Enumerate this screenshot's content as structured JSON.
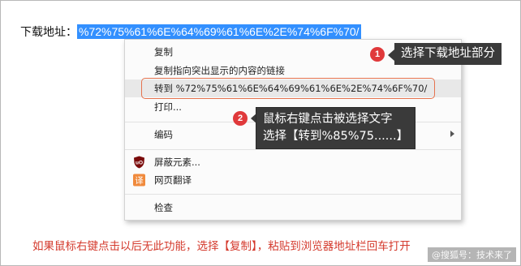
{
  "address": {
    "label": "下载地址：",
    "value": "%72%75%61%6E%64%69%61%6E%2E%74%6F%70/"
  },
  "context_menu": {
    "items": [
      {
        "label": "复制"
      },
      {
        "label": "复制指向突出显示的内容的链接"
      },
      {
        "label": "转到 %72%75%61%6E%64%69%61%6E%2E%74%6F%70/",
        "highlighted": true
      },
      {
        "label": "打印..."
      },
      {
        "label": "编码",
        "has_submenu": true
      },
      {
        "label": "屏蔽元素...",
        "icon": "ublock-shield-icon"
      },
      {
        "label": "网页翻译",
        "icon": "translate-icon"
      },
      {
        "label": "检查"
      }
    ]
  },
  "icons": {
    "ublock_text": "uO",
    "translate_glyph": "译"
  },
  "callouts": [
    {
      "number": "1",
      "lines": [
        "选择下载地址部分"
      ]
    },
    {
      "number": "2",
      "lines": [
        "鼠标右键点击被选择文字",
        "选择【转到%85%75......】"
      ]
    }
  ],
  "note": "如果鼠标右键点击以后无此功能，选择【复制】，粘贴到浏览器地址栏回车打开",
  "watermark": "@搜狐号：技术来了",
  "colors": {
    "selection": "#3390ff",
    "callout_bg": "#3a3a3a",
    "badge": "#e0393b",
    "highlight_box": "#e5734e",
    "note_text": "#d43a2d"
  }
}
